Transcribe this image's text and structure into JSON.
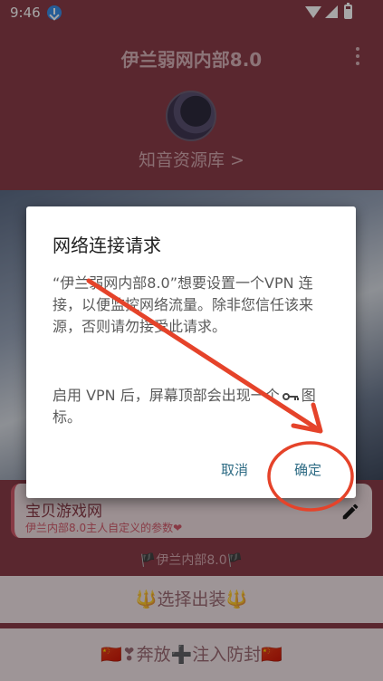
{
  "status_bar": {
    "time": "9:46"
  },
  "app": {
    "title": "伊兰弱网内部8.0"
  },
  "profile": {
    "link": "知音资源库 >"
  },
  "card": {
    "title": "宝贝游戏网",
    "subtitle": "伊兰内部8.0主人自定义的参数❤"
  },
  "version_label": "🏴伊兰内部8.0🏴",
  "buttons": {
    "select": "🔱选择出装🔱",
    "inject": "🇨🇳❣奔放➕注入防封🇨🇳"
  },
  "dialog": {
    "title": "网络连接请求",
    "message_1": "“伊兰弱网内部8.0”想要设置一个VPN 连接，以便监控网络流量。除非您信任该来源，否则请勿接受此请求。",
    "message_2_before": "启用 VPN 后，屏幕顶部会出现一个",
    "message_2_after": "图标。",
    "cancel": "取消",
    "ok": "确定"
  },
  "colors": {
    "accent": "#8b3c49",
    "dialog_button": "#2d6b84",
    "annotation": "#e5432a"
  }
}
